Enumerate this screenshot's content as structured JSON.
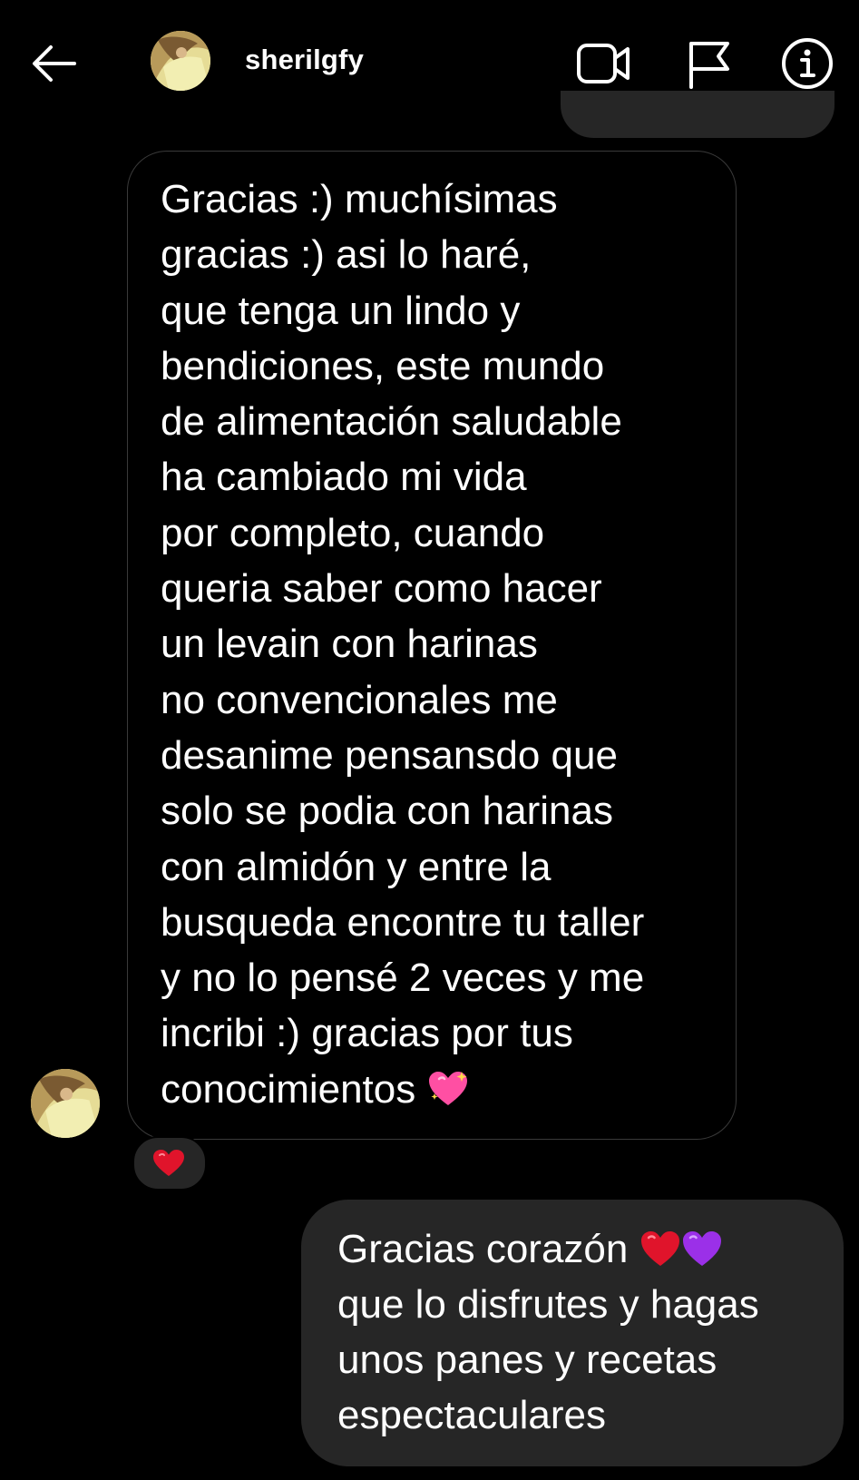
{
  "header": {
    "username": "sherilgfy",
    "back_icon": "arrow-left-icon",
    "video_icon": "video-camera-icon",
    "flag_icon": "flag-icon",
    "info_icon": "info-icon"
  },
  "messages": [
    {
      "direction": "incoming",
      "text": "Gracias :) muchísimas\ngracias :) asi lo haré,\nque tenga un lindo y\nbendiciones, este mundo\nde alimentación saludable\nha cambiado mi vida\npor completo, cuando\nqueria saber como hacer\nun levain con harinas\nno convencionales me\ndesanime pensansdo que\nsolo se podia con harinas\ncon almidón y entre la\nbusqueda encontre tu taller\ny no lo pensé 2 veces y me\nincribi :) gracias por tus\nconocimientos",
      "trailing_emoji": "sparkling-heart-icon",
      "reaction_emoji": "red-heart-icon"
    },
    {
      "direction": "outgoing",
      "lines": [
        "Gracias corazón",
        "que lo disfrutes y hagas",
        "unos panes y recetas",
        "espectaculares"
      ],
      "line1_emojis": [
        "red-heart-icon",
        "purple-heart-icon"
      ]
    }
  ],
  "colors": {
    "background": "#000000",
    "outgoing_bubble": "#262626",
    "incoming_border": "#3a3a3a",
    "red_heart": "#e0142b",
    "purple_heart": "#9b30e8",
    "sparkle_heart": "#ff4fa3"
  }
}
